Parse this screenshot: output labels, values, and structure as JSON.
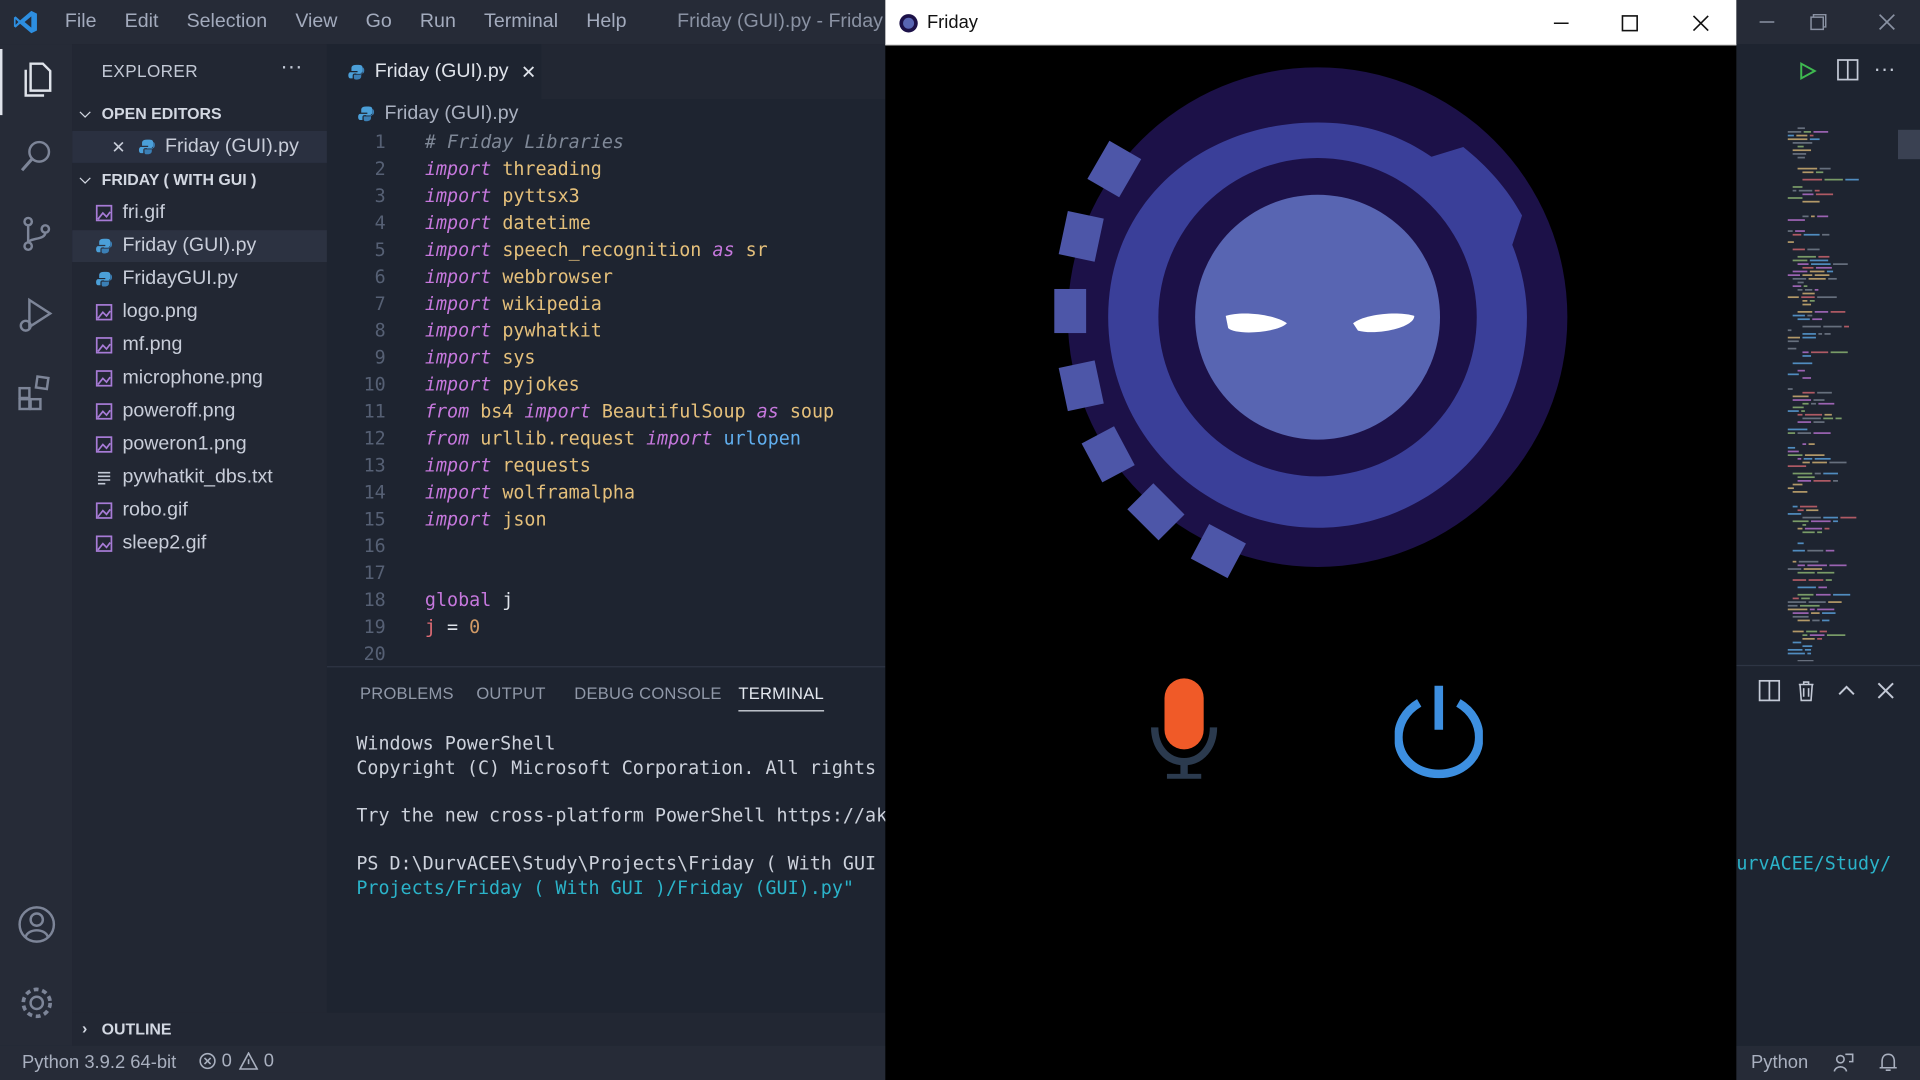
{
  "vscode": {
    "menu": [
      "File",
      "Edit",
      "Selection",
      "View",
      "Go",
      "Run",
      "Terminal",
      "Help"
    ],
    "window_title": "Friday (GUI).py - Friday ( W",
    "explorer": {
      "header": "EXPLORER",
      "open_editors_label": "OPEN EDITORS",
      "open_editor_file": "Friday (GUI).py",
      "folder_label": "FRIDAY ( WITH GUI )",
      "files": [
        {
          "name": "fri.gif",
          "type": "image",
          "selected": false
        },
        {
          "name": "Friday (GUI).py",
          "type": "python",
          "selected": true
        },
        {
          "name": "FridayGUI.py",
          "type": "python",
          "selected": false
        },
        {
          "name": "logo.png",
          "type": "image",
          "selected": false
        },
        {
          "name": "mf.png",
          "type": "image",
          "selected": false
        },
        {
          "name": "microphone.png",
          "type": "image",
          "selected": false
        },
        {
          "name": "poweroff.png",
          "type": "image",
          "selected": false
        },
        {
          "name": "poweron1.png",
          "type": "image",
          "selected": false
        },
        {
          "name": "pywhatkit_dbs.txt",
          "type": "text",
          "selected": false
        },
        {
          "name": "robo.gif",
          "type": "image",
          "selected": false
        },
        {
          "name": "sleep2.gif",
          "type": "image",
          "selected": false
        }
      ],
      "outline_label": "OUTLINE"
    },
    "tab": {
      "label": "Friday (GUI).py",
      "close": "✕"
    },
    "breadcrumb": "Friday (GUI).py",
    "code_lines": [
      {
        "n": "1",
        "tokens": [
          {
            "t": "# Friday Libraries",
            "c": "cmt"
          }
        ]
      },
      {
        "n": "2",
        "tokens": [
          {
            "t": "import",
            "c": "kw"
          },
          {
            "t": " ",
            "c": "id"
          },
          {
            "t": "threading",
            "c": "mod"
          }
        ]
      },
      {
        "n": "3",
        "tokens": [
          {
            "t": "import",
            "c": "kw"
          },
          {
            "t": " ",
            "c": "id"
          },
          {
            "t": "pyttsx3",
            "c": "mod"
          }
        ]
      },
      {
        "n": "4",
        "tokens": [
          {
            "t": "import",
            "c": "kw"
          },
          {
            "t": " ",
            "c": "id"
          },
          {
            "t": "datetime",
            "c": "mod"
          }
        ]
      },
      {
        "n": "5",
        "tokens": [
          {
            "t": "import",
            "c": "kw"
          },
          {
            "t": " ",
            "c": "id"
          },
          {
            "t": "speech_recognition",
            "c": "mod"
          },
          {
            "t": " ",
            "c": "id"
          },
          {
            "t": "as",
            "c": "kw"
          },
          {
            "t": " ",
            "c": "id"
          },
          {
            "t": "sr",
            "c": "mod"
          }
        ]
      },
      {
        "n": "6",
        "tokens": [
          {
            "t": "import",
            "c": "kw"
          },
          {
            "t": " ",
            "c": "id"
          },
          {
            "t": "webbrowser",
            "c": "mod"
          }
        ]
      },
      {
        "n": "7",
        "tokens": [
          {
            "t": "import",
            "c": "kw"
          },
          {
            "t": " ",
            "c": "id"
          },
          {
            "t": "wikipedia",
            "c": "mod"
          }
        ]
      },
      {
        "n": "8",
        "tokens": [
          {
            "t": "import",
            "c": "kw"
          },
          {
            "t": " ",
            "c": "id"
          },
          {
            "t": "pywhatkit",
            "c": "mod"
          }
        ]
      },
      {
        "n": "9",
        "tokens": [
          {
            "t": "import",
            "c": "kw"
          },
          {
            "t": " ",
            "c": "id"
          },
          {
            "t": "sys",
            "c": "mod"
          }
        ]
      },
      {
        "n": "10",
        "tokens": [
          {
            "t": "import",
            "c": "kw"
          },
          {
            "t": " ",
            "c": "id"
          },
          {
            "t": "pyjokes",
            "c": "mod"
          }
        ]
      },
      {
        "n": "11",
        "tokens": [
          {
            "t": "from",
            "c": "kw"
          },
          {
            "t": " ",
            "c": "id"
          },
          {
            "t": "bs4",
            "c": "mod"
          },
          {
            "t": " ",
            "c": "id"
          },
          {
            "t": "import",
            "c": "kw"
          },
          {
            "t": " ",
            "c": "id"
          },
          {
            "t": "BeautifulSoup",
            "c": "mod"
          },
          {
            "t": " ",
            "c": "id"
          },
          {
            "t": "as",
            "c": "kw"
          },
          {
            "t": " ",
            "c": "id"
          },
          {
            "t": "soup",
            "c": "mod"
          }
        ]
      },
      {
        "n": "12",
        "tokens": [
          {
            "t": "from",
            "c": "kw"
          },
          {
            "t": " ",
            "c": "id"
          },
          {
            "t": "urllib.request",
            "c": "mod"
          },
          {
            "t": " ",
            "c": "id"
          },
          {
            "t": "import",
            "c": "kw"
          },
          {
            "t": " ",
            "c": "id"
          },
          {
            "t": "urlopen",
            "c": "fn"
          }
        ]
      },
      {
        "n": "13",
        "tokens": [
          {
            "t": "import",
            "c": "kw"
          },
          {
            "t": " ",
            "c": "id"
          },
          {
            "t": "requests",
            "c": "mod"
          }
        ]
      },
      {
        "n": "14",
        "tokens": [
          {
            "t": "import",
            "c": "kw"
          },
          {
            "t": " ",
            "c": "id"
          },
          {
            "t": "wolframalpha",
            "c": "mod"
          }
        ]
      },
      {
        "n": "15",
        "tokens": [
          {
            "t": "import",
            "c": "kw"
          },
          {
            "t": " ",
            "c": "id"
          },
          {
            "t": "json",
            "c": "mod"
          }
        ]
      },
      {
        "n": "16",
        "tokens": []
      },
      {
        "n": "17",
        "tokens": []
      },
      {
        "n": "18",
        "tokens": [
          {
            "t": "global",
            "c": "kwn"
          },
          {
            "t": " j",
            "c": "id"
          }
        ]
      },
      {
        "n": "19",
        "tokens": [
          {
            "t": "j",
            "c": "var"
          },
          {
            "t": " = ",
            "c": "id"
          },
          {
            "t": "0",
            "c": "num"
          }
        ]
      },
      {
        "n": "20",
        "tokens": []
      }
    ],
    "panel_tabs": [
      "PROBLEMS",
      "OUTPUT",
      "DEBUG CONSOLE",
      "TERMINAL"
    ],
    "terminal_lines": [
      {
        "text": "Windows PowerShell",
        "link": false
      },
      {
        "text": "Copyright (C) Microsoft Corporation. All rights",
        "link": false
      },
      {
        "text": "",
        "link": false
      },
      {
        "text": "Try the new cross-platform PowerShell https://ak",
        "link": false
      },
      {
        "text": "",
        "link": false
      },
      {
        "text": "PS D:\\DurvACEE\\Study\\Projects\\Friday ( With GUI",
        "link": false
      },
      {
        "text": "Projects/Friday ( With GUI )/Friday (GUI).py\"",
        "link": true
      }
    ],
    "terminal_right_fragment": "urvACEE/Study/",
    "status": {
      "python": "Python 3.9.2 64-bit",
      "errors": "0",
      "warnings": "0",
      "language": "Python"
    }
  },
  "friday_app": {
    "title": "Friday",
    "colors": {
      "face_outer": "#1c1148",
      "ring": "#3a3f99",
      "face": "#5865b2",
      "mic": "#f05a28",
      "power": "#3d8fe0"
    }
  },
  "colors": {
    "editor_bg": "#1e2430",
    "sidebar_bg": "#222733",
    "activity_bg": "#262b37"
  }
}
